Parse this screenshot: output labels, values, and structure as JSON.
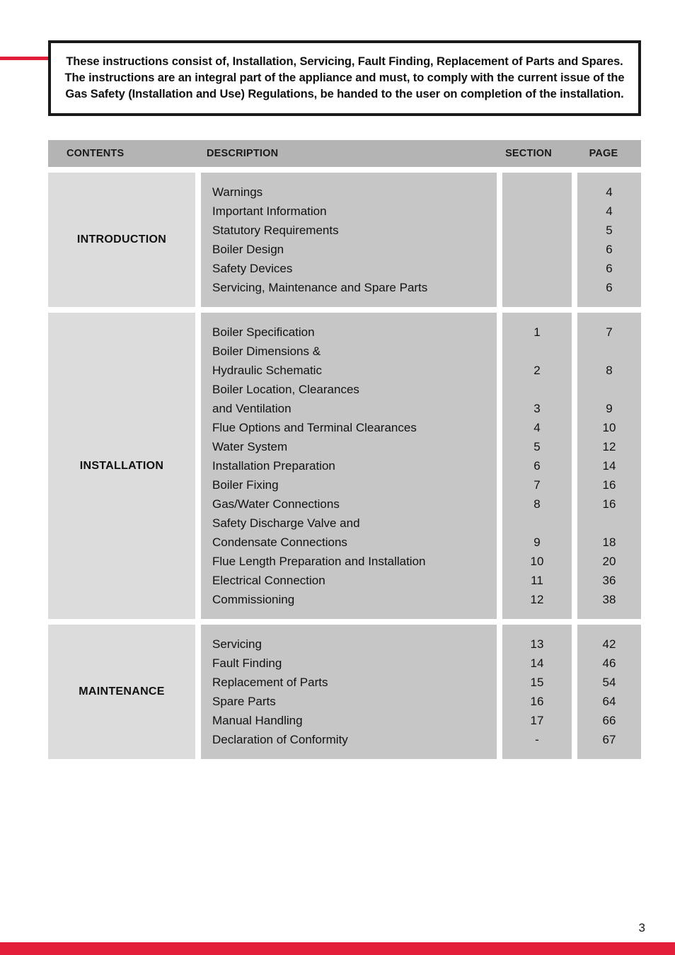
{
  "document": {
    "page_number": "3",
    "accent_color": "#e31e3a",
    "header_bg_color": "#b4b4b4",
    "contents_cell_color": "#dcdcdc",
    "description_cell_color": "#c6c6c6"
  },
  "notice": {
    "text": "These instructions consist of, Installation, Servicing, Fault Finding, Replacement of Parts and Spares. The instructions are an integral part of the appliance and must, to comply with the current issue of the Gas Safety (Installation and Use) Regulations, be handed to the user on completion of the installation."
  },
  "toc": {
    "headers": {
      "contents": "CONTENTS",
      "description": "DESCRIPTION",
      "section": "SECTION",
      "page": "PAGE"
    },
    "groups": [
      {
        "contents": "INTRODUCTION",
        "descriptions": [
          "Warnings",
          "Important Information",
          "Statutory Requirements",
          "Boiler Design",
          "Safety Devices",
          "Servicing, Maintenance and Spare Parts"
        ],
        "sections": [
          "",
          "",
          "",
          "",
          "",
          ""
        ],
        "pages": [
          "4",
          "4",
          "5",
          "6",
          "6",
          "6"
        ]
      },
      {
        "contents": "INSTALLATION",
        "descriptions": [
          "Boiler Specification",
          "Boiler Dimensions &",
          "Hydraulic Schematic",
          "Boiler Location, Clearances",
          "and Ventilation",
          "Flue Options and Terminal Clearances",
          "Water System",
          "Installation Preparation",
          "Boiler Fixing",
          "Gas/Water Connections",
          "Safety Discharge Valve and",
          "Condensate Connections",
          "Flue Length Preparation and Installation",
          "Electrical Connection",
          "Commissioning"
        ],
        "sections": [
          "1",
          "",
          "2",
          "",
          "3",
          "4",
          "5",
          "6",
          "7",
          "8",
          "",
          "9",
          "10",
          "11",
          "12"
        ],
        "pages": [
          "7",
          "",
          "8",
          "",
          "9",
          "10",
          "12",
          "14",
          "16",
          "16",
          "",
          "18",
          "20",
          "36",
          "38"
        ]
      },
      {
        "contents": "MAINTENANCE",
        "descriptions": [
          "Servicing",
          "Fault Finding",
          "Replacement of Parts",
          "Spare Parts",
          "Manual Handling",
          "Declaration of Conformity"
        ],
        "sections": [
          "13",
          "14",
          "15",
          "16",
          "17",
          "-"
        ],
        "pages": [
          "42",
          "46",
          "54",
          "64",
          "66",
          "67"
        ]
      }
    ]
  }
}
